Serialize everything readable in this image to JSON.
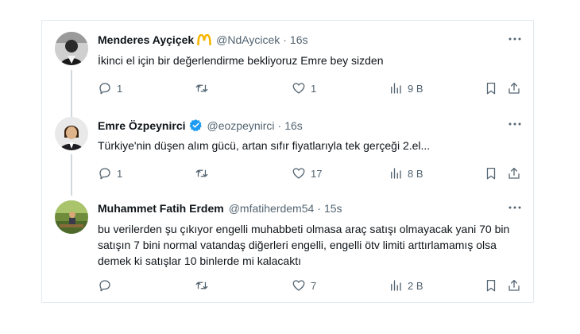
{
  "tweets": [
    {
      "name": "Menderes Ayçiçek",
      "handle": "@NdAycicek",
      "dot": "·",
      "time": "16s",
      "text": "İkinci el için bir değerlendirme bekliyoruz Emre bey sizden",
      "reply_count": "1",
      "retweet_count": "",
      "like_count": "1",
      "view_count": "9 B",
      "badge": "gold-arches-emoji"
    },
    {
      "name": "Emre Özpeynirci",
      "handle": "@eozpeynirci",
      "dot": "·",
      "time": "16s",
      "text": "Türkiye'nin düşen alım gücü, artan sıfır fiyatlarıyla tek gerçeği 2.el...",
      "reply_count": "1",
      "retweet_count": "",
      "like_count": "17",
      "view_count": "8 B",
      "badge": "verified-badge"
    },
    {
      "name": "Muhammet Fatih Erdem",
      "handle": "@mfatiherdem54",
      "dot": "·",
      "time": "15s",
      "text": "bu verilerden şu çıkıyor engelli muhabbeti olmasa araç satışı olmayacak yani 70 bin satışın 7 bini normal vatandaş diğerleri engelli, engelli ötv limiti arttırlamamış olsa demek ki satışlar 10 binlerde mi kalacaktı",
      "reply_count": "",
      "retweet_count": "",
      "like_count": "7",
      "view_count": "2 B",
      "badge": ""
    }
  ],
  "colors": {
    "text": "#0f1419",
    "secondary": "#536471",
    "verified": "#1d9bf0",
    "border": "#e1e8ed",
    "gold": "#f7b500"
  },
  "icons": [
    "reply-icon",
    "retweet-icon",
    "like-icon",
    "views-icon",
    "bookmark-icon",
    "share-icon",
    "more-icon"
  ]
}
